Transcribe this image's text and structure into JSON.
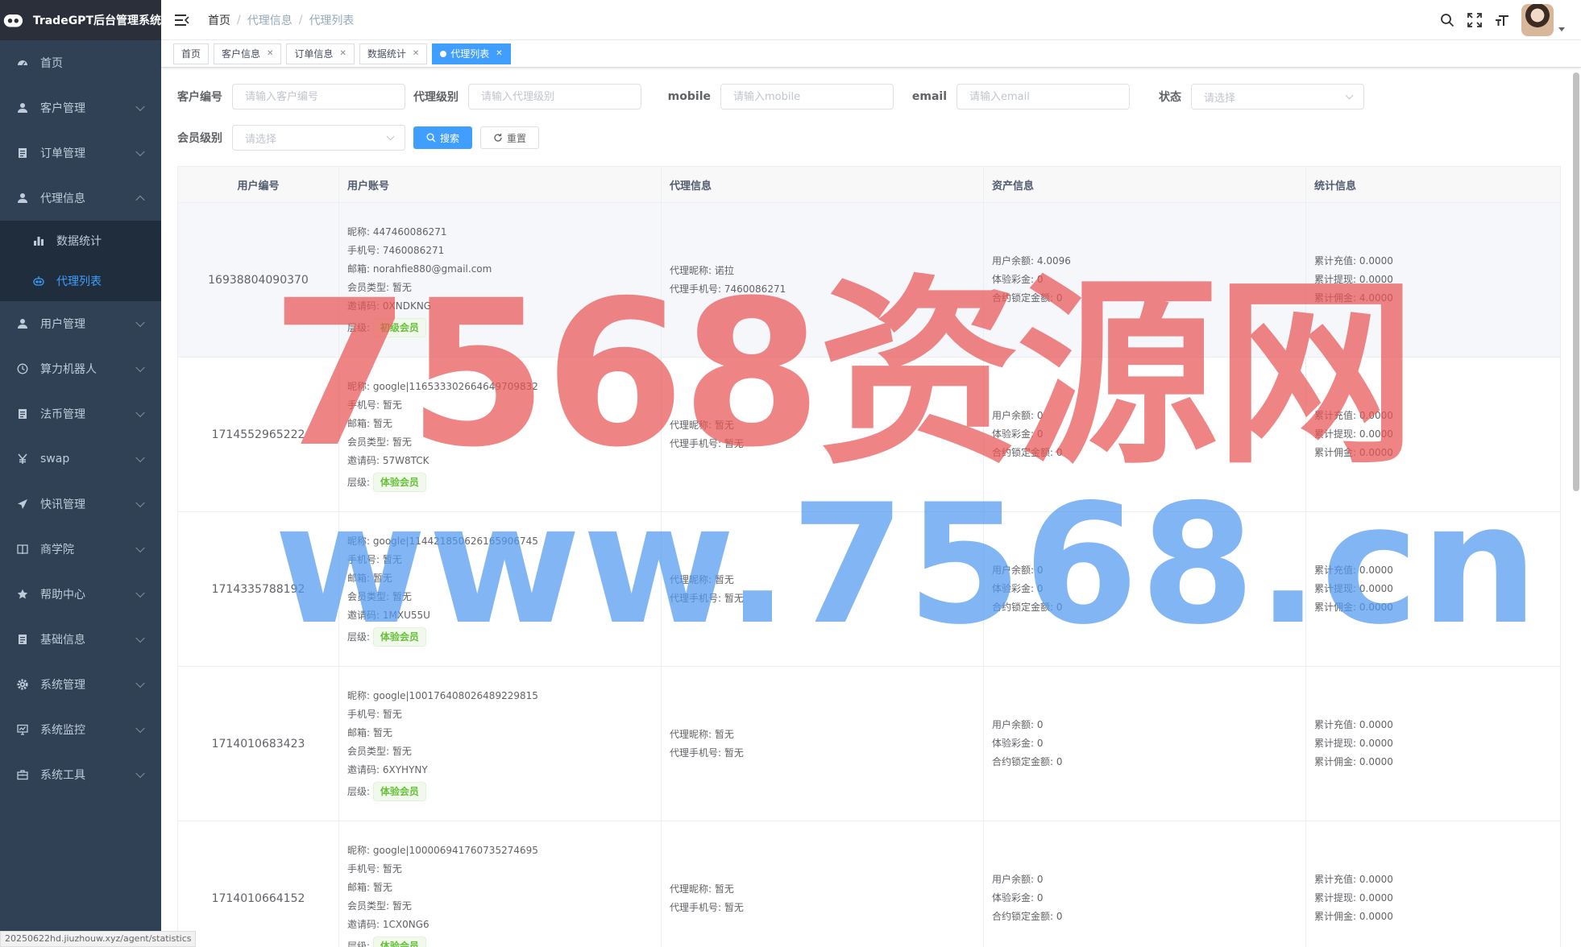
{
  "app": {
    "title": "TradeGPT后台管理系统"
  },
  "sidebar": {
    "items": [
      {
        "label": "首页",
        "icon": "dashboard-icon"
      },
      {
        "label": "客户管理",
        "icon": "user-icon"
      },
      {
        "label": "订单管理",
        "icon": "document-icon"
      },
      {
        "label": "代理信息",
        "icon": "user-icon",
        "expanded": true,
        "children": [
          {
            "label": "数据统计",
            "icon": "bar-chart-icon"
          },
          {
            "label": "代理列表",
            "icon": "robot-icon",
            "active": true
          }
        ]
      },
      {
        "label": "用户管理",
        "icon": "user-icon"
      },
      {
        "label": "算力机器人",
        "icon": "clock-icon"
      },
      {
        "label": "法币管理",
        "icon": "document-icon"
      },
      {
        "label": "swap",
        "icon": "yen-icon"
      },
      {
        "label": "快讯管理",
        "icon": "send-icon"
      },
      {
        "label": "商学院",
        "icon": "book-icon"
      },
      {
        "label": "帮助中心",
        "icon": "star-icon"
      },
      {
        "label": "基础信息",
        "icon": "document-icon"
      },
      {
        "label": "系统管理",
        "icon": "gear-icon"
      },
      {
        "label": "系统监控",
        "icon": "monitor-icon"
      },
      {
        "label": "系统工具",
        "icon": "toolbox-icon"
      }
    ]
  },
  "breadcrumb": [
    "首页",
    "代理信息",
    "代理列表"
  ],
  "tags": [
    {
      "label": "首页",
      "closable": false
    },
    {
      "label": "客户信息",
      "closable": true
    },
    {
      "label": "订单信息",
      "closable": true
    },
    {
      "label": "数据统计",
      "closable": true
    },
    {
      "label": "代理列表",
      "closable": true,
      "active": true
    }
  ],
  "filters": {
    "customer_id": {
      "label": "客户编号",
      "placeholder": "请输入客户编号"
    },
    "agent_level": {
      "label": "代理级别",
      "placeholder": "请输入代理级别"
    },
    "mobile": {
      "label": "mobile",
      "placeholder": "请输入mobile"
    },
    "email": {
      "label": "email",
      "placeholder": "请输入email"
    },
    "status": {
      "label": "状态",
      "placeholder": "请选择"
    },
    "member_level": {
      "label": "会员级别",
      "placeholder": "请选择"
    },
    "search_label": "搜索",
    "reset_label": "重置"
  },
  "table": {
    "headers": [
      "用户编号",
      "用户账号",
      "代理信息",
      "资产信息",
      "统计信息"
    ],
    "field_labels": {
      "nickname": "昵称:",
      "phone": "手机号:",
      "email": "邮箱:",
      "member_type": "会员类型:",
      "invite_code": "邀请码:",
      "level": "层级:",
      "agent_nickname": "代理昵称:",
      "agent_phone": "代理手机号:",
      "balance": "用户余额:",
      "trial_bonus": "体验彩金:",
      "locked": "合约锁定金额:",
      "total_recharge": "累计充值:",
      "total_withdraw": "累计提现:",
      "total_commission": "累计佣金:"
    },
    "rows": [
      {
        "id": "16938804090370",
        "nickname": "447460086271",
        "phone": "7460086271",
        "email": "norahfie880@gmail.com",
        "member_type": "暂无",
        "invite_code": "0XNDKNG",
        "level": "初级会员",
        "agent_nickname": "诺拉",
        "agent_phone": "7460086271",
        "balance": "4.0096",
        "trial_bonus": "0",
        "locked": "0",
        "total_recharge": "0.0000",
        "total_withdraw": "0.0000",
        "total_commission": "4.0000"
      },
      {
        "id": "1714552965222",
        "nickname": "google|116533302664649709832",
        "phone": "暂无",
        "email": "暂无",
        "member_type": "暂无",
        "invite_code": "57W8TCK",
        "level": "体验会员",
        "agent_nickname": "暂无",
        "agent_phone": "暂无",
        "balance": "0",
        "trial_bonus": "0",
        "locked": "0",
        "total_recharge": "0.0000",
        "total_withdraw": "0.0000",
        "total_commission": "0.0000"
      },
      {
        "id": "1714335788192",
        "nickname": "google|114421850626165906745",
        "phone": "暂无",
        "email": "暂无",
        "member_type": "暂无",
        "invite_code": "1MXU55U",
        "level": "体验会员",
        "agent_nickname": "暂无",
        "agent_phone": "暂无",
        "balance": "0",
        "trial_bonus": "0",
        "locked": "0",
        "total_recharge": "0.0000",
        "total_withdraw": "0.0000",
        "total_commission": "0.0000"
      },
      {
        "id": "1714010683423",
        "nickname": "google|100176408026489229815",
        "phone": "暂无",
        "email": "暂无",
        "member_type": "暂无",
        "invite_code": "6XYHYNY",
        "level": "体验会员",
        "agent_nickname": "暂无",
        "agent_phone": "暂无",
        "balance": "0",
        "trial_bonus": "0",
        "locked": "0",
        "total_recharge": "0.0000",
        "total_withdraw": "0.0000",
        "total_commission": "0.0000"
      },
      {
        "id": "1714010664152",
        "nickname": "google|100006941760735274695",
        "phone": "暂无",
        "email": "暂无",
        "member_type": "暂无",
        "invite_code": "1CX0NG6",
        "level": "体验会员",
        "agent_nickname": "暂无",
        "agent_phone": "暂无",
        "balance": "0",
        "trial_bonus": "0",
        "locked": "0",
        "total_recharge": "0.0000",
        "total_withdraw": "0.0000",
        "total_commission": "0.0000"
      }
    ]
  },
  "watermark": {
    "line1": "7568资源网",
    "line2": "www.7568.cn"
  },
  "status_url": "20250622hd.jiuzhouw.xyz/agent/statistics",
  "colors": {
    "sidebar_bg": "#304156",
    "accent": "#409eff",
    "success": "#67c23a"
  }
}
